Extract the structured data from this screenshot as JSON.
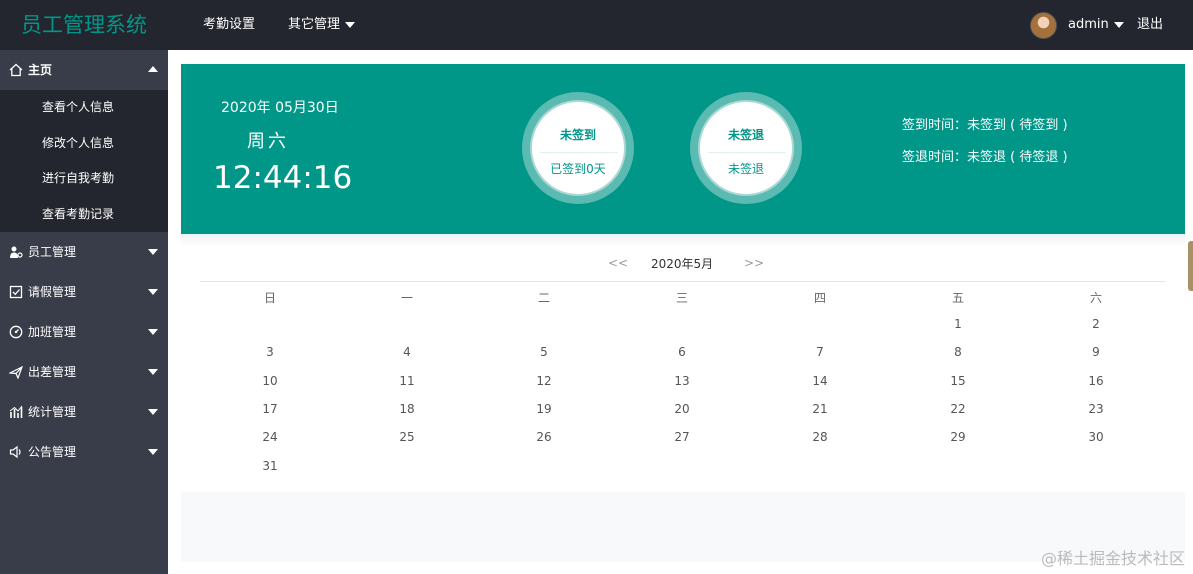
{
  "header": {
    "logo": "员工管理系统",
    "nav": [
      "考勤设置",
      "其它管理"
    ],
    "user": "admin",
    "logout": "退出"
  },
  "sidebar": {
    "home": "主页",
    "home_items": [
      "查看个人信息",
      "修改个人信息",
      "进行自我考勤",
      "查看考勤记录"
    ],
    "groups": [
      "员工管理",
      "请假管理",
      "加班管理",
      "出差管理",
      "统计管理",
      "公告管理"
    ]
  },
  "banner": {
    "date": "2020年 05月30日",
    "weekday": "周六",
    "time": "12:44:16",
    "signin_status": "未签到",
    "signin_days": "已签到0天",
    "signout_status": "未签退",
    "signout_sub": "未签退",
    "signin_line": "签到时间：未签到 ( 待签到 )",
    "signout_line": "签退时间：未签退 ( 待签退 )"
  },
  "calendar": {
    "prev": "<<",
    "title": "2020年5月",
    "next": ">>",
    "weekdays": [
      "日",
      "一",
      "二",
      "三",
      "四",
      "五",
      "六"
    ],
    "weeks": [
      [
        "",
        "",
        "",
        "",
        "",
        "1",
        "2"
      ],
      [
        "3",
        "4",
        "5",
        "6",
        "7",
        "8",
        "9"
      ],
      [
        "10",
        "11",
        "12",
        "13",
        "14",
        "15",
        "16"
      ],
      [
        "17",
        "18",
        "19",
        "20",
        "21",
        "22",
        "23"
      ],
      [
        "24",
        "25",
        "26",
        "27",
        "28",
        "29",
        "30"
      ],
      [
        "31",
        "",
        "",
        "",
        "",
        "",
        ""
      ]
    ]
  },
  "watermark": "@稀土掘金技术社区",
  "colors": {
    "primary": "#009688",
    "header": "#23262e",
    "sidebar": "#393d49"
  }
}
